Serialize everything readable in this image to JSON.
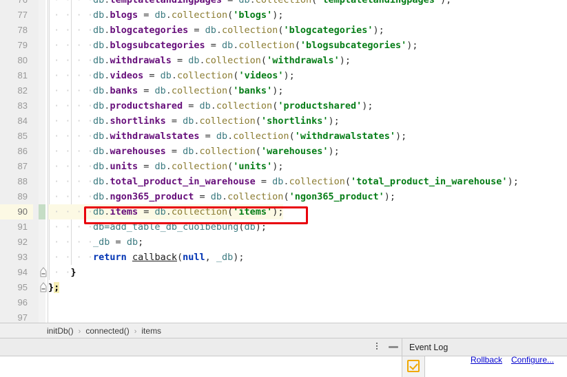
{
  "window": {
    "type": "code-editor"
  },
  "colors": {
    "editor_bg": "#ffffff",
    "gutter_bg": "#efefef",
    "current_line_bg": "#fcf9e4",
    "change_marker": "#c5ddc5",
    "annotation_box": "#e8000b",
    "string_literal": "#067d17",
    "property": "#660e7a",
    "object": "#3b7a80",
    "function": "#8a7b30",
    "keyword": "#0033b3",
    "link": "#0000cd",
    "checkbox_icon": "#f0a800"
  },
  "editor": {
    "first_visible_line": 76,
    "current_line": 90,
    "lines": [
      {
        "number": "76",
        "indent": 2,
        "clipped": true,
        "tokens": [
          {
            "t": "db",
            "c": "t-obj"
          },
          {
            "t": ".",
            "c": "t-dot"
          },
          {
            "t": "templatelandingpages",
            "c": "t-prop"
          },
          {
            "t": " = ",
            "c": "t-punct"
          },
          {
            "t": "db",
            "c": "t-obj"
          },
          {
            "t": ".",
            "c": "t-dot"
          },
          {
            "t": "collection",
            "c": "t-fn"
          },
          {
            "t": "(",
            "c": "t-punct"
          },
          {
            "t": "'templatelandingpages'",
            "c": "t-str"
          },
          {
            "t": ");",
            "c": "t-punct"
          }
        ]
      },
      {
        "number": "77",
        "indent": 2,
        "tokens": [
          {
            "t": "db",
            "c": "t-obj"
          },
          {
            "t": ".",
            "c": "t-dot"
          },
          {
            "t": "blogs",
            "c": "t-prop"
          },
          {
            "t": " = ",
            "c": "t-punct"
          },
          {
            "t": "db",
            "c": "t-obj"
          },
          {
            "t": ".",
            "c": "t-dot"
          },
          {
            "t": "collection",
            "c": "t-fn"
          },
          {
            "t": "(",
            "c": "t-punct"
          },
          {
            "t": "'blogs'",
            "c": "t-str"
          },
          {
            "t": ");",
            "c": "t-punct"
          }
        ]
      },
      {
        "number": "78",
        "indent": 2,
        "tokens": [
          {
            "t": "db",
            "c": "t-obj"
          },
          {
            "t": ".",
            "c": "t-dot"
          },
          {
            "t": "blogcategories",
            "c": "t-prop"
          },
          {
            "t": " = ",
            "c": "t-punct"
          },
          {
            "t": "db",
            "c": "t-obj"
          },
          {
            "t": ".",
            "c": "t-dot"
          },
          {
            "t": "collection",
            "c": "t-fn"
          },
          {
            "t": "(",
            "c": "t-punct"
          },
          {
            "t": "'blogcategories'",
            "c": "t-str"
          },
          {
            "t": ");",
            "c": "t-punct"
          }
        ]
      },
      {
        "number": "79",
        "indent": 2,
        "tokens": [
          {
            "t": "db",
            "c": "t-obj"
          },
          {
            "t": ".",
            "c": "t-dot"
          },
          {
            "t": "blogsubcategories",
            "c": "t-prop"
          },
          {
            "t": " = ",
            "c": "t-punct"
          },
          {
            "t": "db",
            "c": "t-obj"
          },
          {
            "t": ".",
            "c": "t-dot"
          },
          {
            "t": "collection",
            "c": "t-fn"
          },
          {
            "t": "(",
            "c": "t-punct"
          },
          {
            "t": "'blogsubcategories'",
            "c": "t-str"
          },
          {
            "t": ");",
            "c": "t-punct"
          }
        ]
      },
      {
        "number": "80",
        "indent": 2,
        "tokens": [
          {
            "t": "db",
            "c": "t-obj"
          },
          {
            "t": ".",
            "c": "t-dot"
          },
          {
            "t": "withdrawals",
            "c": "t-prop"
          },
          {
            "t": " = ",
            "c": "t-punct"
          },
          {
            "t": "db",
            "c": "t-obj"
          },
          {
            "t": ".",
            "c": "t-dot"
          },
          {
            "t": "collection",
            "c": "t-fn"
          },
          {
            "t": "(",
            "c": "t-punct"
          },
          {
            "t": "'withdrawals'",
            "c": "t-str"
          },
          {
            "t": ");",
            "c": "t-punct"
          }
        ]
      },
      {
        "number": "81",
        "indent": 2,
        "tokens": [
          {
            "t": "db",
            "c": "t-obj"
          },
          {
            "t": ".",
            "c": "t-dot"
          },
          {
            "t": "videos",
            "c": "t-prop"
          },
          {
            "t": " = ",
            "c": "t-punct"
          },
          {
            "t": "db",
            "c": "t-obj"
          },
          {
            "t": ".",
            "c": "t-dot"
          },
          {
            "t": "collection",
            "c": "t-fn"
          },
          {
            "t": "(",
            "c": "t-punct"
          },
          {
            "t": "'videos'",
            "c": "t-str"
          },
          {
            "t": ");",
            "c": "t-punct"
          }
        ]
      },
      {
        "number": "82",
        "indent": 2,
        "tokens": [
          {
            "t": "db",
            "c": "t-obj"
          },
          {
            "t": ".",
            "c": "t-dot"
          },
          {
            "t": "banks",
            "c": "t-prop"
          },
          {
            "t": " = ",
            "c": "t-punct"
          },
          {
            "t": "db",
            "c": "t-obj"
          },
          {
            "t": ".",
            "c": "t-dot"
          },
          {
            "t": "collection",
            "c": "t-fn"
          },
          {
            "t": "(",
            "c": "t-punct"
          },
          {
            "t": "'banks'",
            "c": "t-str"
          },
          {
            "t": ");",
            "c": "t-punct"
          }
        ]
      },
      {
        "number": "83",
        "indent": 2,
        "tokens": [
          {
            "t": "db",
            "c": "t-obj"
          },
          {
            "t": ".",
            "c": "t-dot"
          },
          {
            "t": "productshared",
            "c": "t-prop"
          },
          {
            "t": " = ",
            "c": "t-punct"
          },
          {
            "t": "db",
            "c": "t-obj"
          },
          {
            "t": ".",
            "c": "t-dot"
          },
          {
            "t": "collection",
            "c": "t-fn"
          },
          {
            "t": "(",
            "c": "t-punct"
          },
          {
            "t": "'productshared'",
            "c": "t-str"
          },
          {
            "t": ");",
            "c": "t-punct"
          }
        ]
      },
      {
        "number": "84",
        "indent": 2,
        "tokens": [
          {
            "t": "db",
            "c": "t-obj"
          },
          {
            "t": ".",
            "c": "t-dot"
          },
          {
            "t": "shortlinks",
            "c": "t-prop"
          },
          {
            "t": " = ",
            "c": "t-punct"
          },
          {
            "t": "db",
            "c": "t-obj"
          },
          {
            "t": ".",
            "c": "t-dot"
          },
          {
            "t": "collection",
            "c": "t-fn"
          },
          {
            "t": "(",
            "c": "t-punct"
          },
          {
            "t": "'shortlinks'",
            "c": "t-str"
          },
          {
            "t": ");",
            "c": "t-punct"
          }
        ]
      },
      {
        "number": "85",
        "indent": 2,
        "tokens": [
          {
            "t": "db",
            "c": "t-obj"
          },
          {
            "t": ".",
            "c": "t-dot"
          },
          {
            "t": "withdrawalstates",
            "c": "t-prop"
          },
          {
            "t": " = ",
            "c": "t-punct"
          },
          {
            "t": "db",
            "c": "t-obj"
          },
          {
            "t": ".",
            "c": "t-dot"
          },
          {
            "t": "collection",
            "c": "t-fn"
          },
          {
            "t": "(",
            "c": "t-punct"
          },
          {
            "t": "'withdrawalstates'",
            "c": "t-str"
          },
          {
            "t": ");",
            "c": "t-punct"
          }
        ]
      },
      {
        "number": "86",
        "indent": 2,
        "tokens": [
          {
            "t": "db",
            "c": "t-obj"
          },
          {
            "t": ".",
            "c": "t-dot"
          },
          {
            "t": "warehouses",
            "c": "t-prop"
          },
          {
            "t": " = ",
            "c": "t-punct"
          },
          {
            "t": "db",
            "c": "t-obj"
          },
          {
            "t": ".",
            "c": "t-dot"
          },
          {
            "t": "collection",
            "c": "t-fn"
          },
          {
            "t": "(",
            "c": "t-punct"
          },
          {
            "t": "'warehouses'",
            "c": "t-str"
          },
          {
            "t": ");",
            "c": "t-punct"
          }
        ]
      },
      {
        "number": "87",
        "indent": 2,
        "tokens": [
          {
            "t": "db",
            "c": "t-obj"
          },
          {
            "t": ".",
            "c": "t-dot"
          },
          {
            "t": "units",
            "c": "t-prop"
          },
          {
            "t": " = ",
            "c": "t-punct"
          },
          {
            "t": "db",
            "c": "t-obj"
          },
          {
            "t": ".",
            "c": "t-dot"
          },
          {
            "t": "collection",
            "c": "t-fn"
          },
          {
            "t": "(",
            "c": "t-punct"
          },
          {
            "t": "'units'",
            "c": "t-str"
          },
          {
            "t": ");",
            "c": "t-punct"
          }
        ]
      },
      {
        "number": "88",
        "indent": 2,
        "tokens": [
          {
            "t": "db",
            "c": "t-obj"
          },
          {
            "t": ".",
            "c": "t-dot"
          },
          {
            "t": "total_product_in_warehouse",
            "c": "t-prop"
          },
          {
            "t": " = ",
            "c": "t-punct"
          },
          {
            "t": "db",
            "c": "t-obj"
          },
          {
            "t": ".",
            "c": "t-dot"
          },
          {
            "t": "collection",
            "c": "t-fn"
          },
          {
            "t": "(",
            "c": "t-punct"
          },
          {
            "t": "'total_product_in_warehouse'",
            "c": "t-str"
          },
          {
            "t": ");",
            "c": "t-punct"
          }
        ]
      },
      {
        "number": "89",
        "indent": 2,
        "tokens": [
          {
            "t": "db",
            "c": "t-obj"
          },
          {
            "t": ".",
            "c": "t-dot"
          },
          {
            "t": "ngon365_product",
            "c": "t-prop"
          },
          {
            "t": " = ",
            "c": "t-punct"
          },
          {
            "t": "db",
            "c": "t-obj"
          },
          {
            "t": ".",
            "c": "t-dot"
          },
          {
            "t": "collection",
            "c": "t-fn"
          },
          {
            "t": "(",
            "c": "t-punct"
          },
          {
            "t": "'ngon365_product'",
            "c": "t-str"
          },
          {
            "t": ");",
            "c": "t-punct"
          }
        ]
      },
      {
        "number": "90",
        "indent": 2,
        "current": true,
        "changed": true,
        "has_intention_bulb": true,
        "annotated": true,
        "tokens": [
          {
            "t": "db",
            "c": "t-obj"
          },
          {
            "t": ".",
            "c": "t-dot"
          },
          {
            "t": "items",
            "c": "t-prop"
          },
          {
            "t": " = ",
            "c": "t-punct"
          },
          {
            "t": "db",
            "c": "t-obj"
          },
          {
            "t": ".",
            "c": "t-dot"
          },
          {
            "t": "collection",
            "c": "t-fn"
          },
          {
            "t": "(",
            "c": "t-punct"
          },
          {
            "t": "'items'",
            "c": "t-str"
          },
          {
            "t": ");",
            "c": "t-punct"
          }
        ]
      },
      {
        "number": "91",
        "indent": 2,
        "tokens": [
          {
            "t": "db=add_table_db_cuoibebung",
            "c": "t-obj"
          },
          {
            "t": "(",
            "c": "t-punct"
          },
          {
            "t": "db",
            "c": "t-obj"
          },
          {
            "t": ");",
            "c": "t-punct"
          }
        ]
      },
      {
        "number": "92",
        "indent": 2,
        "tokens": [
          {
            "t": "_db",
            "c": "t-obj"
          },
          {
            "t": " = ",
            "c": "t-punct"
          },
          {
            "t": "db",
            "c": "t-obj"
          },
          {
            "t": ";",
            "c": "t-punct"
          }
        ]
      },
      {
        "number": "93",
        "indent": 2,
        "tokens": [
          {
            "t": "return",
            "c": "t-kw"
          },
          {
            "t": " ",
            "c": "t-punct"
          },
          {
            "t": "callback",
            "c": "t-call"
          },
          {
            "t": "(",
            "c": "t-punct"
          },
          {
            "t": "null",
            "c": "t-kw"
          },
          {
            "t": ", ",
            "c": "t-punct"
          },
          {
            "t": "_db",
            "c": "t-obj"
          },
          {
            "t": ");",
            "c": "t-punct"
          }
        ]
      },
      {
        "number": "94",
        "indent": 1,
        "fold": true,
        "tokens": [
          {
            "t": "}",
            "c": "t-brace"
          }
        ]
      },
      {
        "number": "95",
        "indent": 0,
        "fold": true,
        "tokens": [
          {
            "t": "}",
            "c": "t-brace"
          },
          {
            "t": ";",
            "c": "t-brace t-sel"
          }
        ]
      },
      {
        "number": "96",
        "indent": 0,
        "tokens": []
      },
      {
        "number": "97",
        "indent": 0,
        "tokens": []
      }
    ]
  },
  "breadcrumb": {
    "separator": "›",
    "items": [
      {
        "label": "initDb()"
      },
      {
        "label": "connected()"
      },
      {
        "label": "items"
      }
    ]
  },
  "bottom_panel": {
    "more_options_icon": "vertical-dots-icon",
    "hide_icon": "minimize-icon",
    "title": "Event Log",
    "checkbox_icon": "checkbox-checked-icon",
    "links": [
      {
        "label": "Rollback"
      },
      {
        "label": "Configure..."
      }
    ]
  }
}
